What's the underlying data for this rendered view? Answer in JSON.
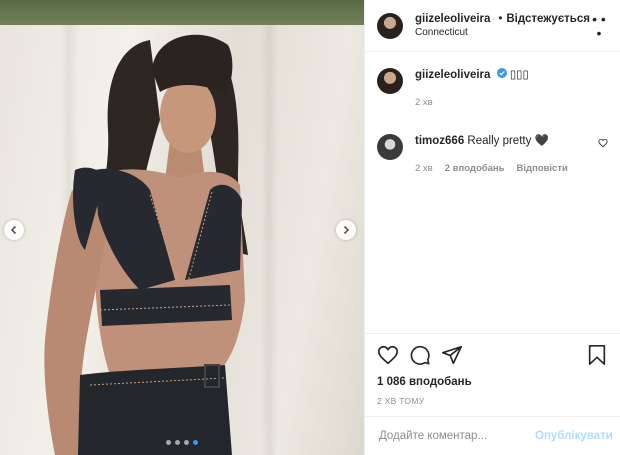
{
  "post": {
    "author": {
      "username": "giizeleoliveira",
      "location": "Connecticut",
      "follow_label": "Відстежується",
      "separator": "•"
    },
    "caption": {
      "username": "giizeleoliveira",
      "text": "▯▯▯",
      "age": "2 хв"
    },
    "comments": [
      {
        "username": "timoz666",
        "text": "Really pretty 🖤",
        "age": "2 хв",
        "likes": "2 вподобань",
        "reply_label": "Відповісти"
      }
    ],
    "likes_count": "1 086 вподобань",
    "posted_time": "2 ХВ ТОМУ",
    "add_comment_placeholder": "Додайте коментар...",
    "publish_label": "Опублікувати",
    "carousel": {
      "total": 4,
      "active": 4
    },
    "colors": {
      "accent": "#3897f0",
      "text": "#262626",
      "muted": "#8e8e8e",
      "publish_disabled": "#b3dbff"
    },
    "icons": [
      "prev-arrow-icon",
      "next-arrow-icon",
      "verified-badge-icon",
      "more-options-icon",
      "heart-icon",
      "comment-icon",
      "share-icon",
      "bookmark-icon"
    ]
  }
}
